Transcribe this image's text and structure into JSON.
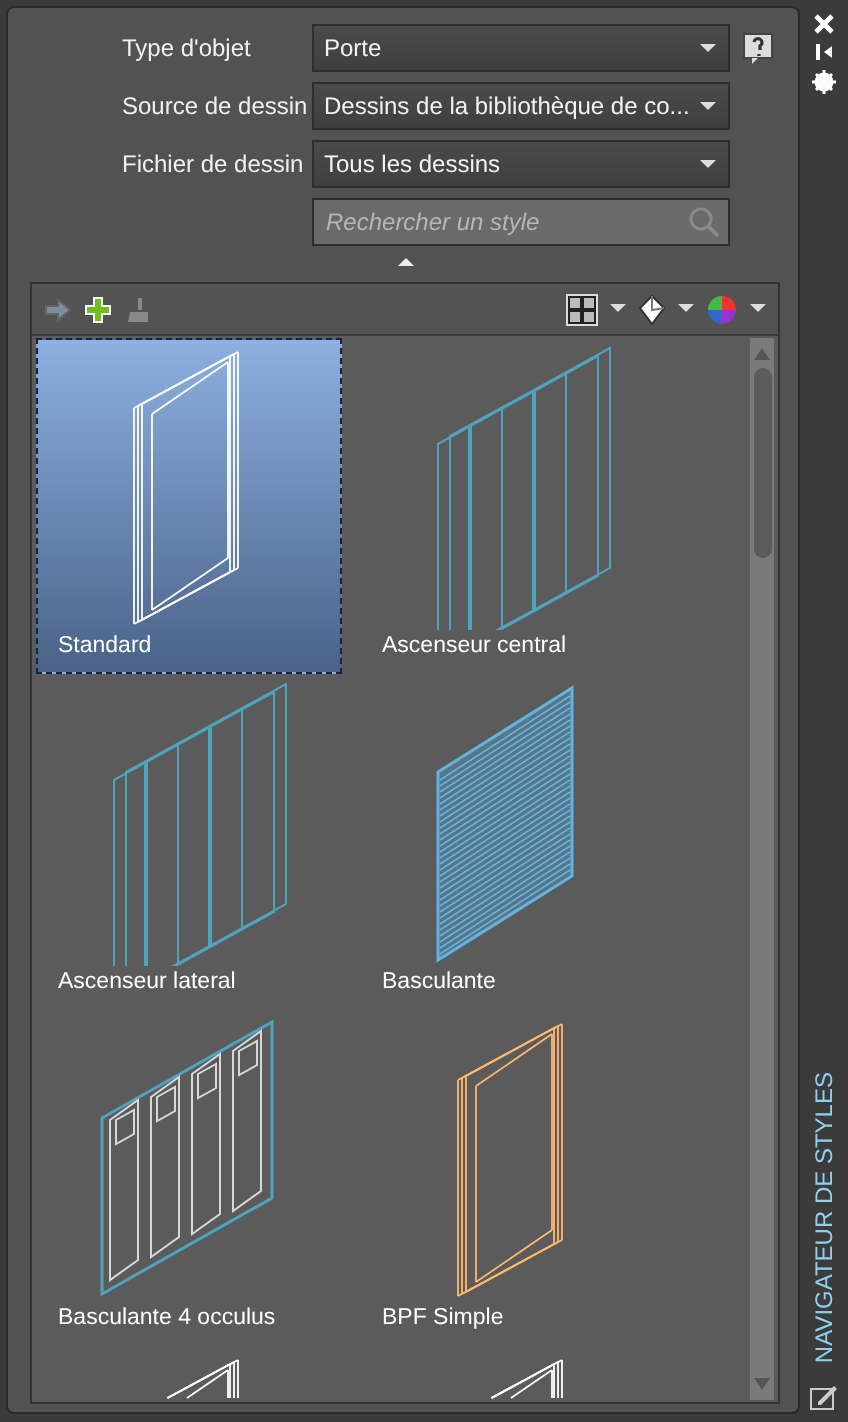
{
  "window": {
    "title": "NAVIGATEUR DE STYLES"
  },
  "fields": [
    {
      "kind": "select",
      "label": "Type d'objet",
      "value": "Porte"
    },
    {
      "kind": "select",
      "label": "Source de dessin",
      "value": "Dessins de la bibliothèque de co..."
    },
    {
      "kind": "select",
      "label": "Fichier de dessin",
      "value": "Tous les dessins"
    },
    {
      "kind": "search",
      "placeholder": "Rechercher un style"
    }
  ],
  "styles": [
    {
      "name": "Standard",
      "kind": "frame",
      "color": "#ffffff",
      "selected": true
    },
    {
      "name": "Ascenseur central",
      "kind": "slider",
      "color": "#4fa3bb",
      "selected": false
    },
    {
      "name": "Ascenseur lateral",
      "kind": "slider",
      "color": "#4fa3bb",
      "selected": false
    },
    {
      "name": "Basculante",
      "kind": "louver",
      "color": "#62b4e0",
      "selected": false
    },
    {
      "name": "Basculante 4 occulus",
      "kind": "panels",
      "color": "#d8d8d8",
      "selected": false
    },
    {
      "name": "BPF Simple",
      "kind": "frame",
      "color": "#ffb86b",
      "selected": false
    },
    {
      "kind": "frame",
      "color": "#ffffff",
      "selected": false
    },
    {
      "kind": "frame",
      "color": "#ffffff",
      "selected": false
    }
  ]
}
